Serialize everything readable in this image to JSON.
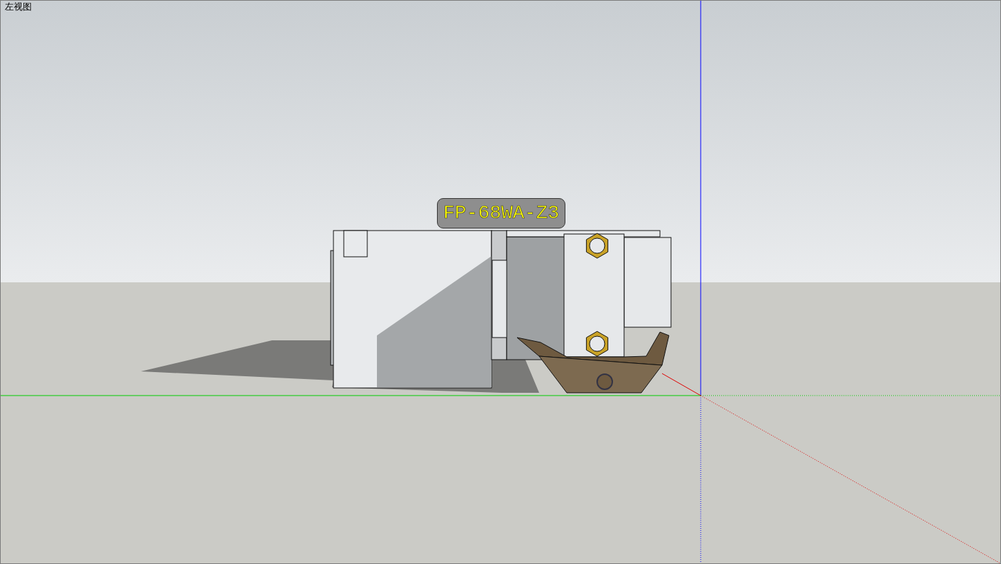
{
  "view": {
    "title": "左视图"
  },
  "model_tag": {
    "label": "FP-68WA-Z3"
  }
}
